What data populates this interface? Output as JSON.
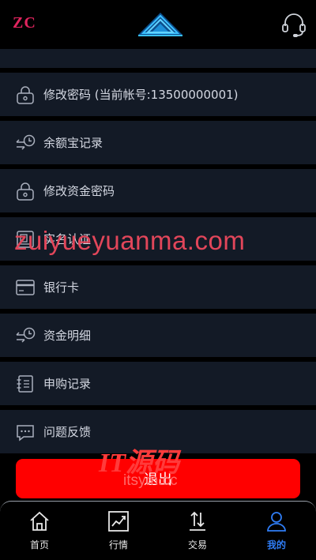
{
  "header": {
    "brand": "ZC",
    "center_logo_icon": "pyramid-logo-icon",
    "support_icon": "headset-icon"
  },
  "menu": {
    "items": [
      {
        "label": "修改密码 (当前帐号:13500000001)",
        "icon": "lock-icon"
      },
      {
        "label": "余额宝记录",
        "icon": "transfer-clock-icon"
      },
      {
        "label": "修改资金密码",
        "icon": "lock-icon"
      },
      {
        "label": "实名认证",
        "icon": "id-card-icon"
      },
      {
        "label": "银行卡",
        "icon": "bank-card-icon"
      },
      {
        "label": "资金明细",
        "icon": "transfer-clock-icon"
      },
      {
        "label": "申购记录",
        "icon": "notebook-icon"
      },
      {
        "label": "问题反馈",
        "icon": "chat-icon"
      }
    ]
  },
  "logout": {
    "label": "退出"
  },
  "watermarks": {
    "domain": "zuiyueyuanma.com",
    "brand": "IT源码",
    "site": "itsym.cc"
  },
  "tabbar": {
    "tabs": [
      {
        "label": "首页",
        "icon": "home-icon"
      },
      {
        "label": "行情",
        "icon": "chart-icon"
      },
      {
        "label": "交易",
        "icon": "trade-arrows-icon"
      },
      {
        "label": "我的",
        "icon": "user-icon"
      }
    ],
    "active_index": 3
  },
  "colors": {
    "background": "#000000",
    "row": "#131a26",
    "brand": "#e0245e",
    "logout": "#ff0000",
    "active_tab": "#2f7df6"
  }
}
